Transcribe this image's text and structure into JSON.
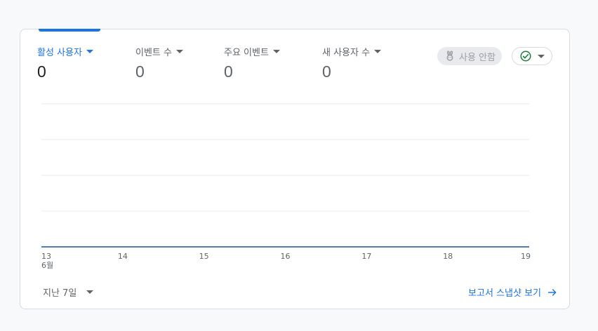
{
  "metrics": [
    {
      "label": "활성 사용자",
      "value": "0",
      "active": true
    },
    {
      "label": "이벤트 수",
      "value": "0",
      "active": false
    },
    {
      "label": "주요 이벤트",
      "value": "0",
      "active": false
    },
    {
      "label": "새 사용자 수",
      "value": "0",
      "active": false
    }
  ],
  "no_use_chip": {
    "label": "사용 안함",
    "icon": "bunny-icon"
  },
  "status_chip": {
    "icon": "check-circle-icon",
    "color": "#188038"
  },
  "chart_data": {
    "type": "line",
    "x_ticks": [
      "13",
      "14",
      "15",
      "16",
      "17",
      "18",
      "19"
    ],
    "x_month_label": "6월",
    "series": [
      {
        "values": [
          0,
          0,
          0,
          0,
          0,
          0,
          0
        ]
      }
    ],
    "grid": true
  },
  "date_range": {
    "label": "지난 7일"
  },
  "report_link": {
    "label": "보고서 스냅샷 보기"
  },
  "colors": {
    "accent": "#1a73e8",
    "line": "#4a7fc0",
    "success": "#188038"
  }
}
